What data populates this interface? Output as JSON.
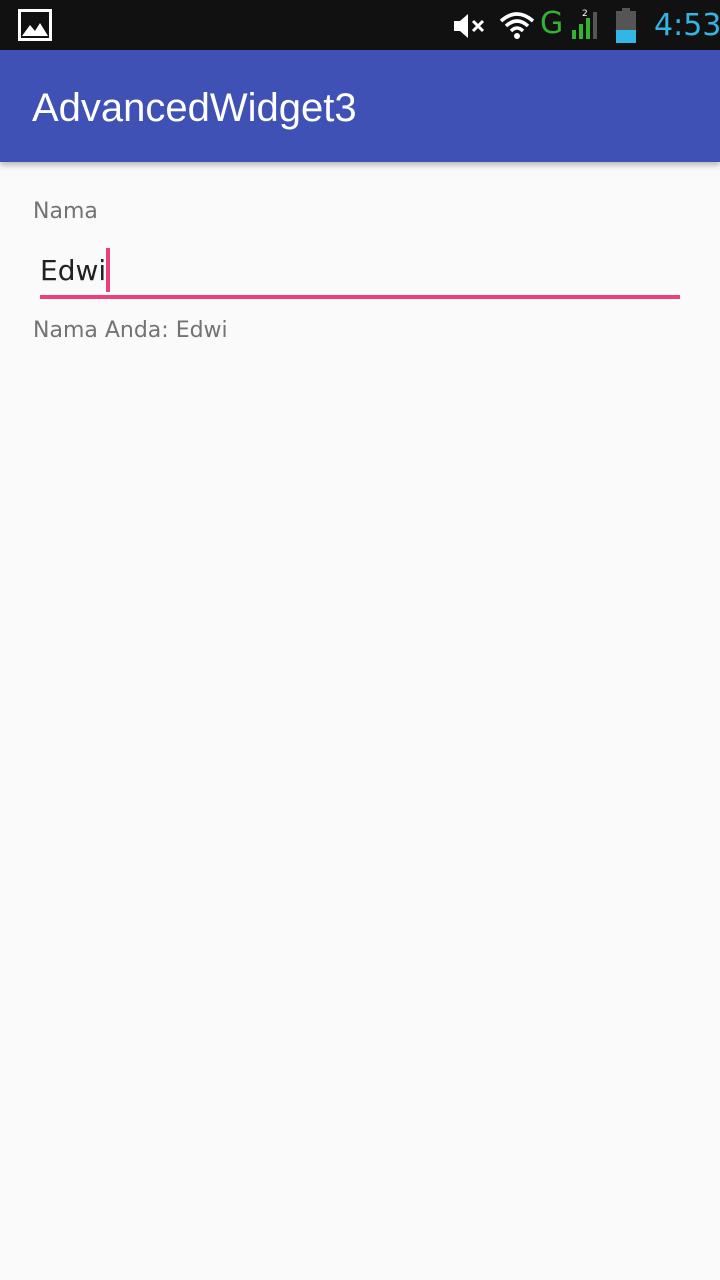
{
  "status_bar": {
    "time": "4:53",
    "network_type": "G",
    "signal_badge": "2",
    "icons": [
      "gallery-icon",
      "mute-icon",
      "wifi-icon",
      "signal-icon",
      "battery-icon"
    ],
    "time_color": "#33b5e5",
    "network_color": "#33b334"
  },
  "app_bar": {
    "title": "AdvancedWidget3",
    "color": "#3f51b5"
  },
  "form": {
    "label": "Nama",
    "input_value": "Edwi",
    "accent_color": "#ec407a"
  },
  "result": {
    "text": "Nama Anda: Edwi"
  }
}
